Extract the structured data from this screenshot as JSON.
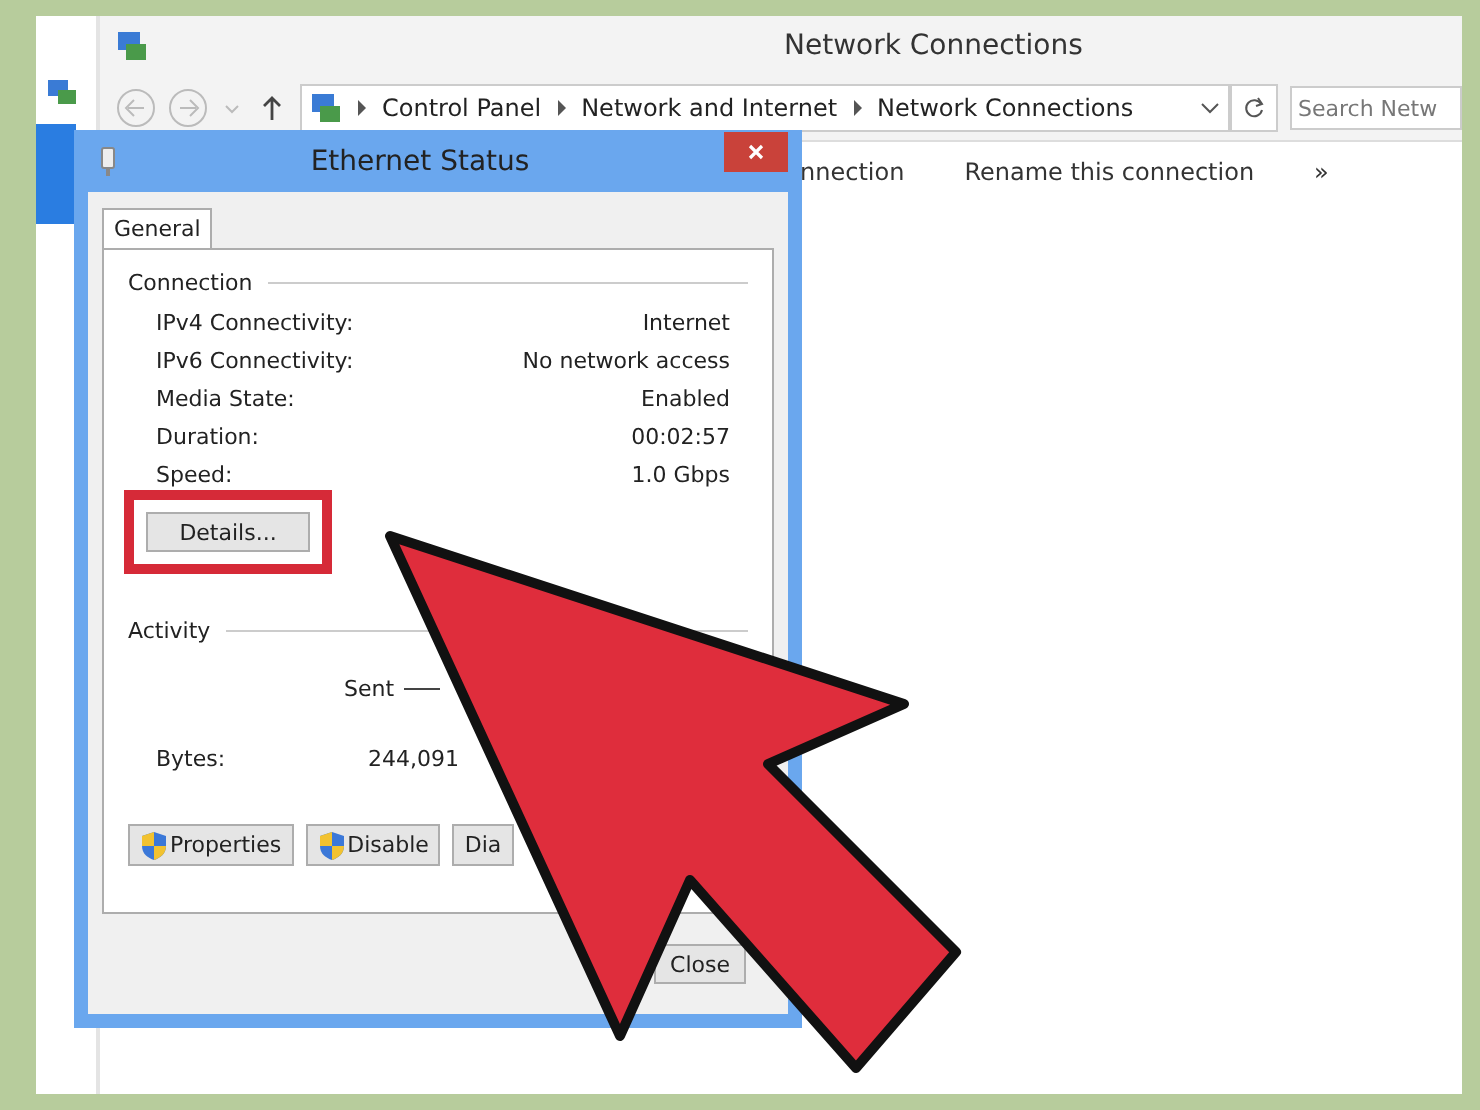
{
  "window": {
    "title": "Network Connections"
  },
  "address_bar": {
    "breadcrumbs": [
      "Control Panel",
      "Network and Internet",
      "Network Connections"
    ],
    "search": {
      "placeholder": "Search Netw"
    }
  },
  "toolbar": {
    "items": [
      "nnection",
      "Rename this connection",
      "»"
    ]
  },
  "dialog": {
    "title": "Ethernet Status",
    "tabs": [
      {
        "label": "General",
        "selected": true
      }
    ],
    "connection": {
      "heading": "Connection",
      "rows": [
        {
          "label": "IPv4 Connectivity:",
          "value": "Internet"
        },
        {
          "label": "IPv6 Connectivity:",
          "value": "No network access"
        },
        {
          "label": "Media State:",
          "value": "Enabled"
        },
        {
          "label": "Duration:",
          "value": "00:02:57"
        },
        {
          "label": "Speed:",
          "value": "1.0 Gbps"
        }
      ],
      "details_button": {
        "label": "Details...",
        "highlighted": true
      }
    },
    "activity": {
      "heading": "Activity",
      "sent_label": "Sent",
      "rows": [
        {
          "label": "Bytes:",
          "sent": "244,091"
        }
      ]
    },
    "buttons": [
      {
        "label": "Properties",
        "shield": true
      },
      {
        "label": "Disable",
        "shield": true
      },
      {
        "label": "Dia",
        "shield": false
      }
    ],
    "close_button": "Close"
  }
}
